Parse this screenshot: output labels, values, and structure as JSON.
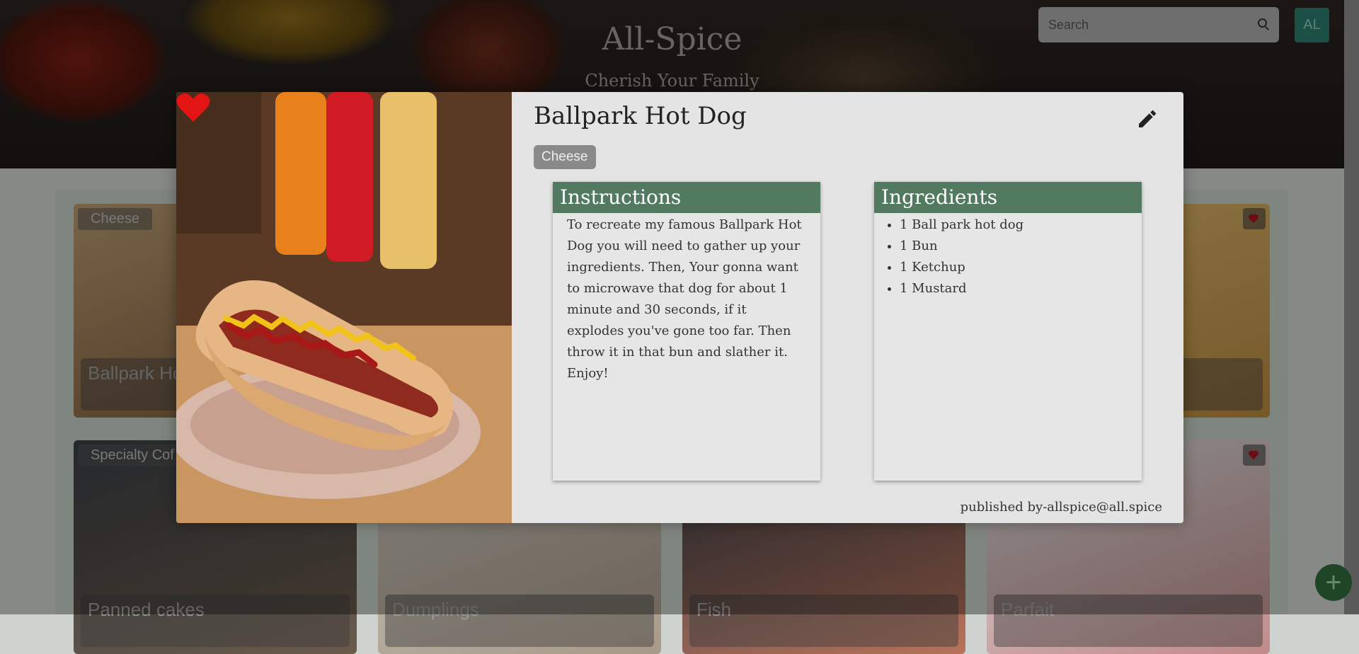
{
  "header": {
    "title": "All-Spice",
    "subtitle": "Cherish Your Family",
    "search_placeholder": "Search",
    "avatar_initials": "AL"
  },
  "background_cards": [
    {
      "category": "Cheese",
      "name": "Ballpark Ho"
    },
    {
      "category": "Specialty Cof",
      "name": "Panned cakes"
    },
    {
      "category": "",
      "name": "Dumplings"
    },
    {
      "category": "",
      "name": "Fish"
    },
    {
      "category": "",
      "name": "Parfait"
    }
  ],
  "fab_label": "+",
  "modal": {
    "title": "Ballpark Hot Dog",
    "tag": "Cheese",
    "instructions_heading": "Instructions",
    "instructions_text": "To recreate my famous Ballpark Hot Dog you will need to gather up your ingredients. Then, Your gonna want to microwave that dog for about 1 minute and 30 seconds, if it explodes you've gone too far. Then throw it in that bun and slather it. Enjoy!",
    "ingredients_heading": "Ingredients",
    "ingredients": [
      "1 Ball park hot dog",
      "1 Bun",
      "1 Ketchup",
      "1 Mustard"
    ],
    "published": "published by-allspice@all.spice",
    "favorite": true
  },
  "colors": {
    "panel_header": "#527a60",
    "heart": "#e21414",
    "avatar": "#2b7a6a"
  }
}
